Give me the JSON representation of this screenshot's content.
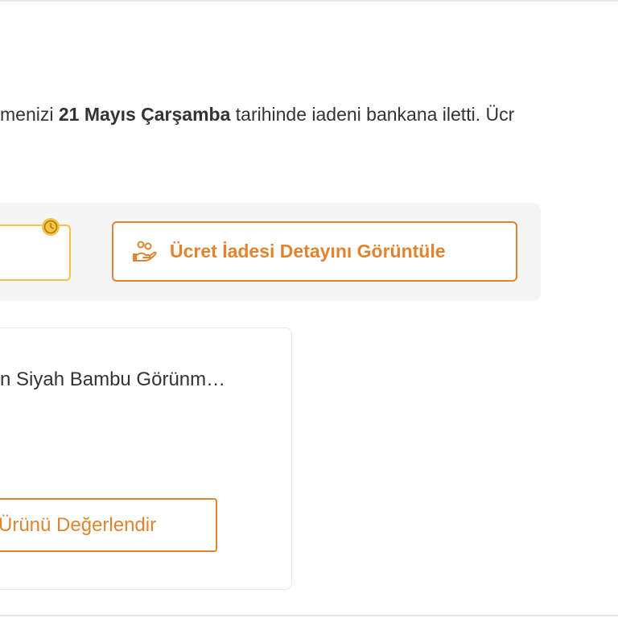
{
  "info": {
    "prefix": "menizi ",
    "date": "21 Mayıs Çarşamba",
    "suffix": " tarihinde iadeni bankana iletti. Ücr"
  },
  "actions": {
    "refund_detail_label": "Ücret İadesi Detayını Görüntüle",
    "refund_icon": "hand-coins-icon",
    "status_icon": "clock-icon"
  },
  "product": {
    "title": "n Siyah Bambu Görünm…",
    "rate_label": "Ürünü Değerlendir"
  },
  "colors": {
    "accent": "#e2842f",
    "status_yellow": "#f6c24a",
    "bar_background": "#f5f5f5"
  }
}
